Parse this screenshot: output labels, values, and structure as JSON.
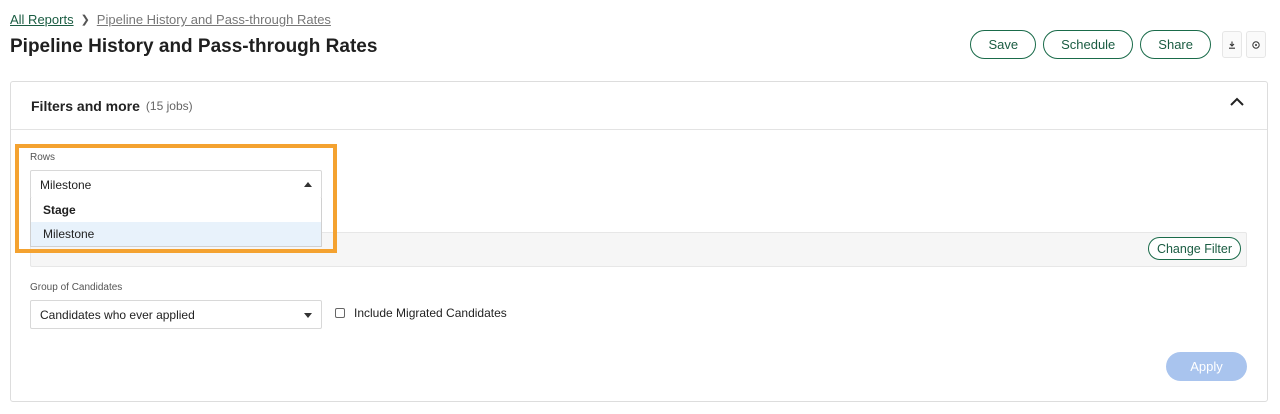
{
  "breadcrumb": {
    "root": "All Reports",
    "current": "Pipeline History and Pass-through Rates"
  },
  "page": {
    "title": "Pipeline History and Pass-through Rates"
  },
  "actions": {
    "save": "Save",
    "schedule": "Schedule",
    "share": "Share",
    "download_icon": "download-icon",
    "help_icon": "help-icon"
  },
  "filters": {
    "title": "Filters and more",
    "count": "(15 jobs)",
    "collapse_icon": "chevron-up-icon",
    "rows": {
      "label": "Rows",
      "selected": "Milestone",
      "options": [
        "Stage",
        "Milestone"
      ]
    },
    "change_filter": "Change Filter",
    "group": {
      "label": "Group of Candidates",
      "selected": "Candidates who ever applied"
    },
    "include_migrated": "Include Migrated Candidates",
    "apply": "Apply"
  },
  "colors": {
    "brand_green": "#1a6b4a",
    "highlight_orange": "#f4a230",
    "apply_disabled": "#a9c4ee",
    "option_hover": "#e8f2fb"
  }
}
